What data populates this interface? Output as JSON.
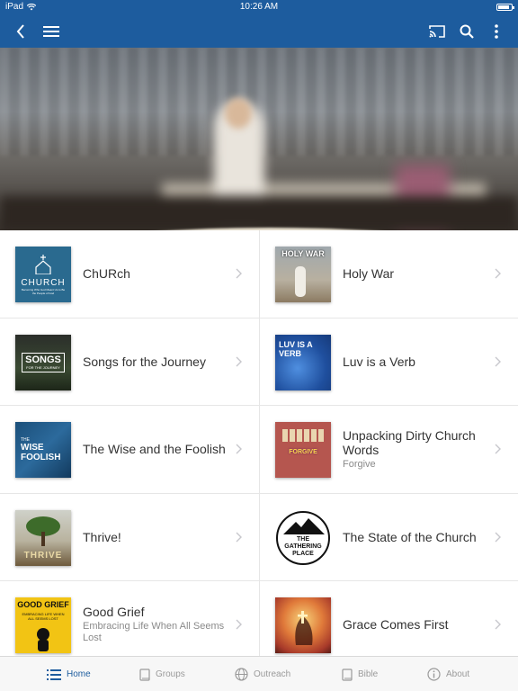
{
  "status_bar": {
    "device": "iPad",
    "time": "10:26 AM"
  },
  "nav": {
    "back_icon": "chevron-left-icon",
    "menu_icon": "hamburger-icon",
    "cast_icon": "cast-icon",
    "search_icon": "search-icon",
    "more_icon": "more-vertical-icon"
  },
  "series": [
    {
      "title": "ChURch",
      "subtitle": "",
      "thumb_text": "CHURCH",
      "thumb_subtext": "Becoming Who God Meant Us to Be the People of God"
    },
    {
      "title": "Holy War",
      "subtitle": "",
      "thumb_text": "HOLY WAR",
      "thumb_subtext": ""
    },
    {
      "title": "Songs for the Journey",
      "subtitle": "",
      "thumb_text": "SONGS",
      "thumb_subtext": "FOR THE JOURNEY"
    },
    {
      "title": "Luv is a Verb",
      "subtitle": "",
      "thumb_text": "LUV IS A VERB",
      "thumb_subtext": ""
    },
    {
      "title": "The Wise and the Foolish",
      "subtitle": "",
      "thumb_text": "WISE FOOLISH",
      "thumb_subtext": "THE"
    },
    {
      "title": "Unpacking Dirty Church Words",
      "subtitle": "Forgive",
      "thumb_text": "FORGIVE",
      "thumb_subtext": ""
    },
    {
      "title": "Thrive!",
      "subtitle": "",
      "thumb_text": "THRIVE",
      "thumb_subtext": ""
    },
    {
      "title": "The State of the Church",
      "subtitle": "",
      "thumb_text": "THE GATHERING PLACE",
      "thumb_subtext": ""
    },
    {
      "title": "Good Grief",
      "subtitle": "Embracing Life When All Seems Lost",
      "thumb_text": "GOOD GRIEF",
      "thumb_subtext": "EMBRACING LIFE WHEN ALL SEEMS LOST"
    },
    {
      "title": "Grace Comes First",
      "subtitle": "",
      "thumb_text": "",
      "thumb_subtext": ""
    }
  ],
  "tabs": [
    {
      "label": "Home",
      "icon": "list-icon",
      "active": true
    },
    {
      "label": "Groups",
      "icon": "book-icon",
      "active": false
    },
    {
      "label": "Outreach",
      "icon": "globe-icon",
      "active": false
    },
    {
      "label": "Bible",
      "icon": "bible-icon",
      "active": false
    },
    {
      "label": "About",
      "icon": "info-icon",
      "active": false
    }
  ],
  "colors": {
    "brand": "#1d5c9e",
    "tab_inactive": "#9a9a9a"
  }
}
